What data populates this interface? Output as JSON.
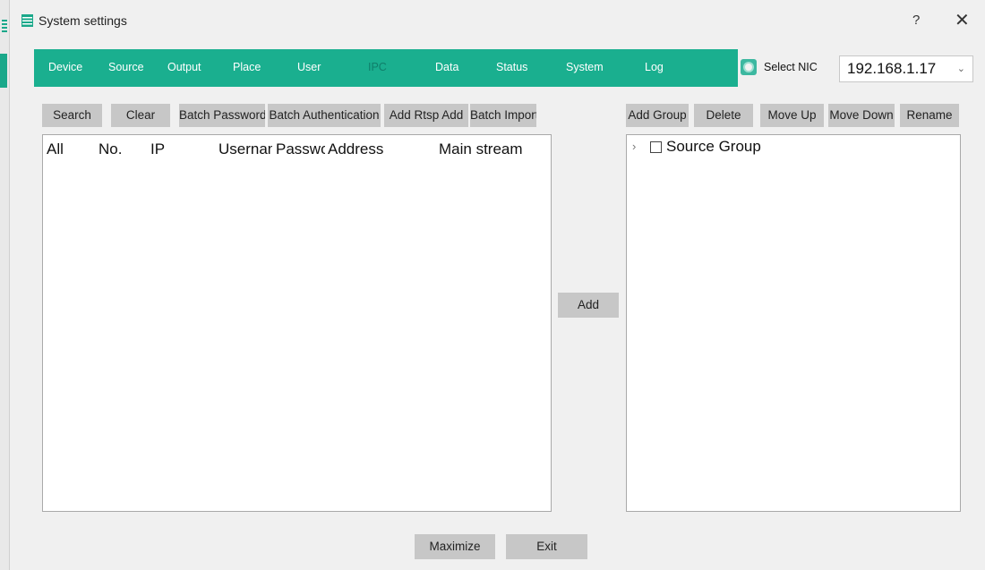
{
  "window": {
    "title": "System settings",
    "help": "?",
    "close": "✕"
  },
  "nav": {
    "items": [
      "Device",
      "Source",
      "Output",
      "Place",
      "User",
      "IPC",
      "Data",
      "Status",
      "System",
      "Log"
    ],
    "active": "IPC"
  },
  "nic": {
    "label": "Select NIC",
    "value": "192.168.1.17",
    "arrow": "⌄",
    "icon": "gear-icon"
  },
  "left_toolbar": {
    "search": "Search",
    "clear": "Clear",
    "batch_password": "Batch Password",
    "batch_authentication": "Batch Authentication",
    "add_rtsp": "Add Rtsp Add",
    "batch_import": "Batch Import"
  },
  "table": {
    "columns": [
      "All",
      "No.",
      "IP",
      "Username",
      "Password",
      "Address",
      "Main stream"
    ]
  },
  "add_button": "Add",
  "right_toolbar": {
    "add_group": "Add Group",
    "delete": "Delete",
    "move_up": "Move Up",
    "move_down": "Move Down",
    "rename": "Rename"
  },
  "tree": {
    "items": [
      {
        "label": "Source Group",
        "expander": "›"
      }
    ]
  },
  "footer": {
    "maximize": "Maximize",
    "exit": "Exit"
  },
  "colors": {
    "accent": "#1aaf8f",
    "button": "#c7c7c7",
    "active_tab": "#0f7f6a"
  }
}
